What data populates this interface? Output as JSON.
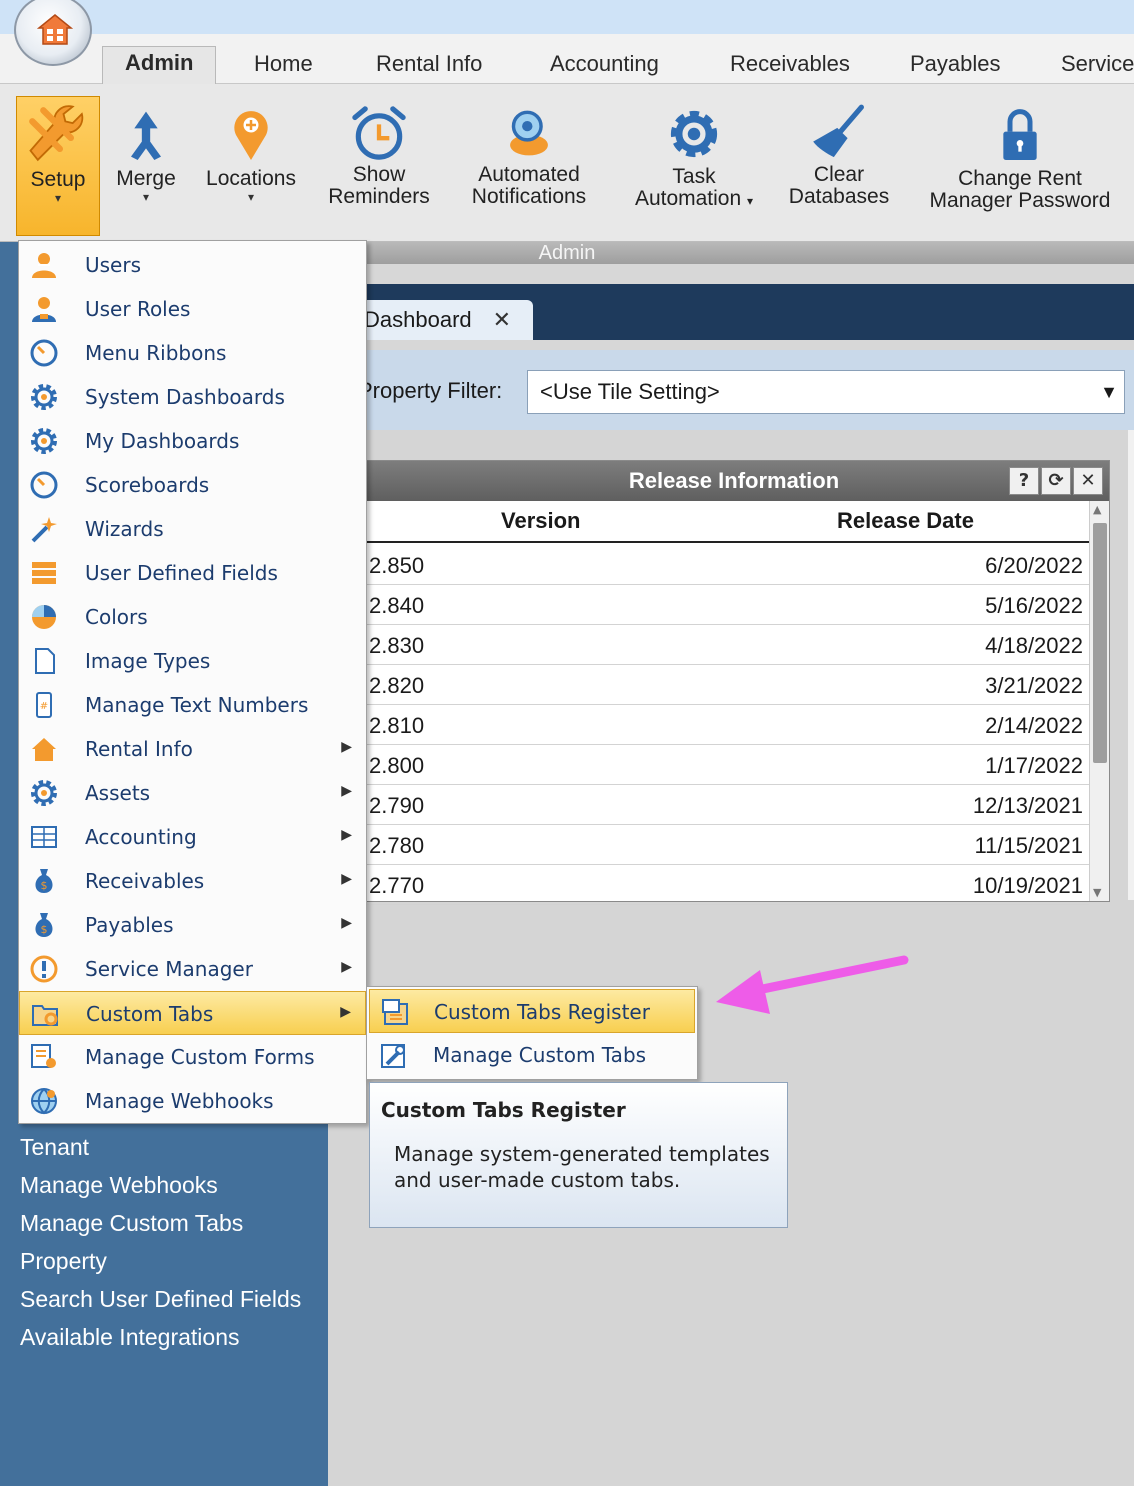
{
  "ribbon_tabs": [
    "Admin",
    "Home",
    "Rental Info",
    "Accounting",
    "Receivables",
    "Payables",
    "Service"
  ],
  "ribbon_buttons": {
    "setup": "Setup",
    "merge": "Merge",
    "locations": "Locations",
    "show_reminders": [
      "Show",
      "Reminders"
    ],
    "automated_notifications": [
      "Automated",
      "Notifications"
    ],
    "task_automation": [
      "Task",
      "Automation"
    ],
    "clear_databases": [
      "Clear",
      "Databases"
    ],
    "change_password": [
      "Change Rent",
      "Manager Password"
    ]
  },
  "ribbon_group_label": "Admin",
  "setup_menu": [
    {
      "label": "Users",
      "icon": "users-icon",
      "submenu": false
    },
    {
      "label": "User Roles",
      "icon": "user-roles-icon",
      "submenu": false
    },
    {
      "label": "Menu Ribbons",
      "icon": "gauge-icon",
      "submenu": false
    },
    {
      "label": "System Dashboards",
      "icon": "gear-icon",
      "submenu": false
    },
    {
      "label": "My Dashboards",
      "icon": "gear-icon",
      "submenu": false
    },
    {
      "label": "Scoreboards",
      "icon": "gauge-icon",
      "submenu": false
    },
    {
      "label": "Wizards",
      "icon": "wand-icon",
      "submenu": false
    },
    {
      "label": "User Defined Fields",
      "icon": "fields-icon",
      "submenu": false
    },
    {
      "label": "Colors",
      "icon": "color-wheel-icon",
      "submenu": false
    },
    {
      "label": "Image Types",
      "icon": "document-icon",
      "submenu": false
    },
    {
      "label": "Manage Text Numbers",
      "icon": "phone-icon",
      "submenu": false
    },
    {
      "label": "Rental Info",
      "icon": "house-icon",
      "submenu": true
    },
    {
      "label": "Assets",
      "icon": "gear-icon",
      "submenu": true
    },
    {
      "label": "Accounting",
      "icon": "ledger-icon",
      "submenu": true
    },
    {
      "label": "Receivables",
      "icon": "money-bag-icon",
      "submenu": true
    },
    {
      "label": "Payables",
      "icon": "money-bag-icon",
      "submenu": true
    },
    {
      "label": "Service Manager",
      "icon": "alert-icon",
      "submenu": true
    },
    {
      "label": "Custom Tabs",
      "icon": "folder-gear-icon",
      "submenu": true,
      "highlighted": true
    },
    {
      "label": "Manage Custom Forms",
      "icon": "forms-icon",
      "submenu": false
    },
    {
      "label": "Manage Webhooks",
      "icon": "globe-icon",
      "submenu": false
    }
  ],
  "custom_tabs_submenu": [
    {
      "label": "Custom Tabs Register",
      "icon": "register-icon",
      "highlighted": true
    },
    {
      "label": "Manage Custom Tabs",
      "icon": "wrench-doc-icon"
    }
  ],
  "tooltip": {
    "title": "Custom Tabs Register",
    "body": "Manage system-generated templates and user-made custom tabs."
  },
  "sidebar_items": [
    "Tenant",
    "Manage Webhooks",
    "Manage Custom Tabs",
    "Property",
    "Search User Defined Fields",
    "Available Integrations"
  ],
  "document_tab": {
    "label": "Dashboard",
    "close": "✕"
  },
  "filter": {
    "label": "Property Filter:",
    "value": "<Use Tile Setting>"
  },
  "release_tile": {
    "title": "Release Information",
    "buttons": [
      "?",
      "⟳",
      "✕"
    ],
    "columns": [
      "Version",
      "Release Date"
    ],
    "rows": [
      [
        "2.850",
        "6/20/2022"
      ],
      [
        "2.840",
        "5/16/2022"
      ],
      [
        "2.830",
        "4/18/2022"
      ],
      [
        "2.820",
        "3/21/2022"
      ],
      [
        "2.810",
        "2/14/2022"
      ],
      [
        "2.800",
        "1/17/2022"
      ],
      [
        "2.790",
        "12/13/2021"
      ],
      [
        "2.780",
        "11/15/2021"
      ],
      [
        "2.770",
        "10/19/2021"
      ]
    ]
  },
  "colors": {
    "accent_orange": "#f39a2e",
    "ribbon_blue": "#2f6db3",
    "sidebar": "#43709b",
    "highlight": "#f8cf50",
    "annotation_arrow": "#ee5ce8"
  }
}
